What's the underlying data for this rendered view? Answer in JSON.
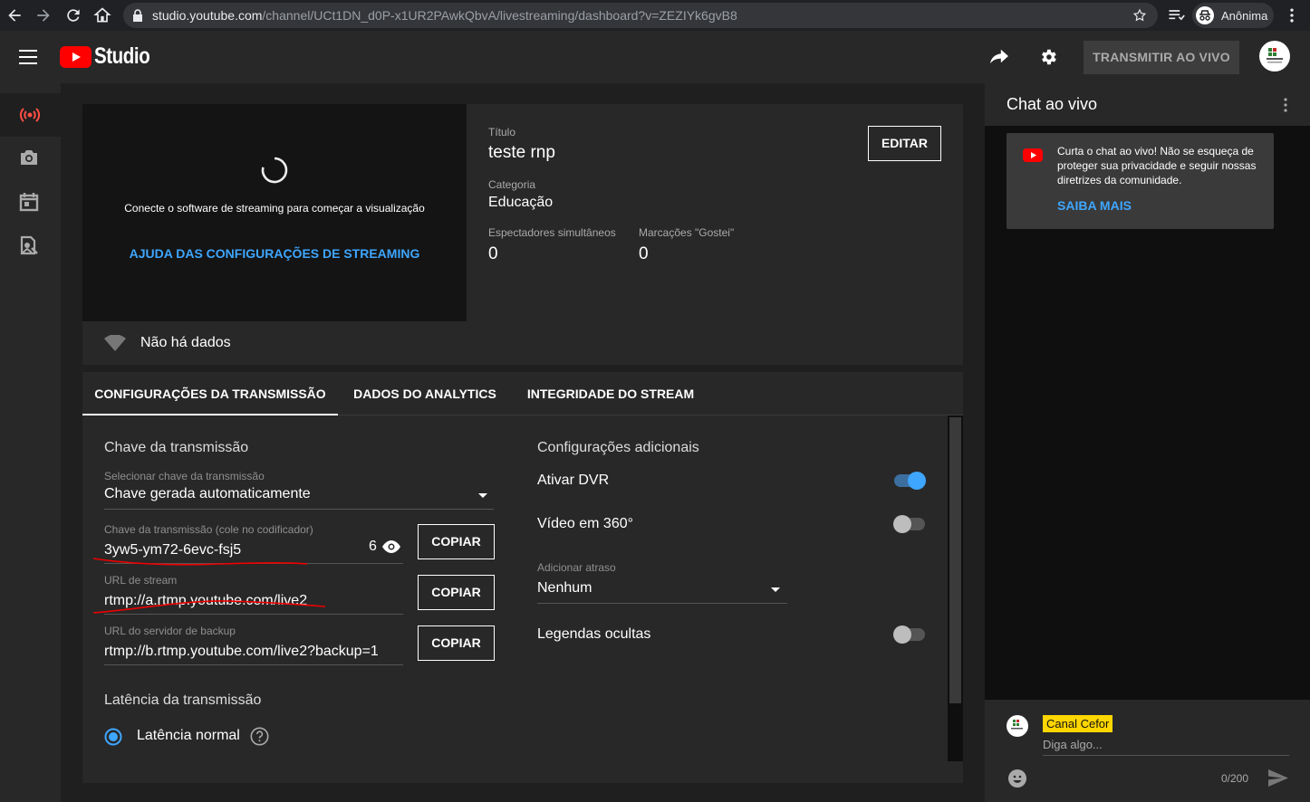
{
  "browser": {
    "url_host": "studio.youtube.com",
    "url_path": "/channel/UCt1DN_d0P-x1UR2PAwkQbvA/livestreaming/dashboard?v=ZEZIYk6gvB8",
    "profile": "Anônima"
  },
  "header": {
    "brand": "Studio",
    "go_live": "TRANSMITIR AO VIVO"
  },
  "nav": {
    "items": [
      "live-stream-icon",
      "camera-icon",
      "calendar-icon",
      "manage-icon"
    ]
  },
  "preview": {
    "message": "Conecte o software de streaming para começar a visualização",
    "help_link": "AJUDA DAS CONFIGURAÇÕES DE STREAMING"
  },
  "info": {
    "title_label": "Título",
    "title_value": "teste rnp",
    "category_label": "Categoria",
    "category_value": "Educação",
    "viewers_label": "Espectadores simultâneos",
    "viewers_value": "0",
    "likes_label": "Marcações \"Gostei\"",
    "likes_value": "0",
    "edit": "EDITAR"
  },
  "status": {
    "no_data": "Não há dados"
  },
  "tabs": [
    "CONFIGURAÇÕES DA TRANSMISSÃO",
    "DADOS DO ANALYTICS",
    "INTEGRIDADE DO STREAM"
  ],
  "stream_key": {
    "section_title": "Chave da transmissão",
    "select_label": "Selecionar chave da transmissão",
    "select_value": "Chave gerada automaticamente",
    "key_label": "Chave da transmissão (cole no codificador)",
    "key_value": "3yw5-ym72-6evc-fsj5",
    "key_suffix": "6",
    "url_label": "URL de stream",
    "url_value": "rtmp://a.rtmp.youtube.com/live2",
    "backup_label": "URL do servidor de backup",
    "backup_value": "rtmp://b.rtmp.youtube.com/live2?backup=1",
    "copy": "COPIAR"
  },
  "latency": {
    "section_title": "Latência da transmissão",
    "option": "Latência normal"
  },
  "additional": {
    "section_title": "Configurações adicionais",
    "dvr_label": "Ativar DVR",
    "dvr_on": true,
    "video360_label": "Vídeo em 360°",
    "video360_on": false,
    "delay_label": "Adicionar atraso",
    "delay_value": "Nenhum",
    "captions_label": "Legendas ocultas",
    "captions_on": false
  },
  "chat": {
    "title": "Chat ao vivo",
    "notice": "Curta o chat ao vivo! Não se esqueça de proteger sua privacidade e seguir nossas diretrizes da comunidade.",
    "notice_link": "SAIBA MAIS",
    "channel_name": "Canal Cefor",
    "input_placeholder": "Diga algo...",
    "char_count": "0/200"
  },
  "colors": {
    "accent": "#3ea6ff",
    "live_red": "#ff4e45",
    "brand_red": "#ff0000",
    "badge_yellow": "#ffd600"
  }
}
